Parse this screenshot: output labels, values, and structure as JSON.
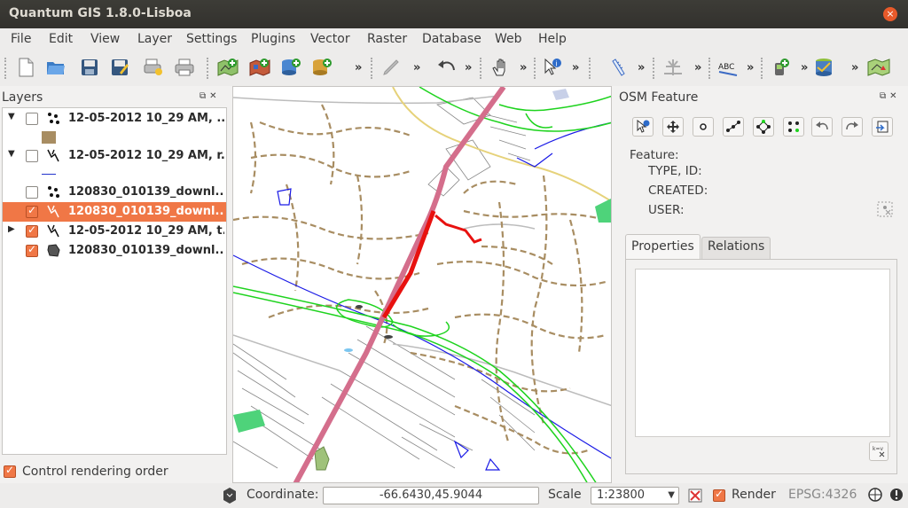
{
  "window": {
    "title": "Quantum GIS 1.8.0-Lisboa",
    "close_glyph": "×"
  },
  "menu": [
    "File",
    "Edit",
    "View",
    "Layer",
    "Settings",
    "Plugins",
    "Vector",
    "Raster",
    "Database",
    "Web",
    "Help"
  ],
  "toolbar": {
    "icons": [
      "new-project-icon",
      "open-project-icon",
      "save-project-icon",
      "save-as-icon",
      "new-print-composer-icon",
      "print-icon",
      "add-vector-layer-icon",
      "add-raster-layer-icon",
      "add-postgis-layer-icon",
      "add-spatialite-layer-icon",
      "pencil-edit-icon",
      "undo-icon",
      "pan-hand-icon",
      "identify-icon",
      "measure-icon",
      "snapping-icon",
      "label-icon",
      "gps-icon",
      "database-icon",
      "georeferencer-icon"
    ],
    "overflow_glyph": "»"
  },
  "layers_panel": {
    "title": "Layers",
    "rows": [
      {
        "label": "12-05-2012 10_29 AM, ...",
        "checked": false,
        "expander": "▼",
        "icon": "points-icon"
      },
      {
        "label": "12-05-2012 10_29 AM, r...",
        "checked": false,
        "expander": "▼",
        "icon": "lines-icon"
      },
      {
        "label": "120830_010139_downl...",
        "checked": false,
        "expander": "",
        "icon": "points-icon"
      },
      {
        "label": "120830_010139_downl...",
        "checked": true,
        "expander": "",
        "icon": "lines-icon",
        "selected": true
      },
      {
        "label": "12-05-2012 10_29 AM, t...",
        "checked": true,
        "expander": "▶",
        "icon": "lines-icon"
      },
      {
        "label": "120830_010139_downl...",
        "checked": true,
        "expander": "",
        "icon": "polygon-icon"
      }
    ],
    "control_rendering_order": "Control rendering order"
  },
  "osm_panel": {
    "title": "OSM Feature",
    "feature_label": "Feature:",
    "type_id_label": "TYPE, ID:",
    "created_label": "CREATED:",
    "user_label": "USER:",
    "tabs": [
      "Properties",
      "Relations"
    ],
    "tools": [
      "identify-feature-icon",
      "move-feature-icon",
      "create-point-icon",
      "create-line-icon",
      "create-polygon-icon",
      "select-nodes-icon",
      "undo-icon",
      "redo-icon",
      "import-data-icon"
    ]
  },
  "statusbar": {
    "coordinate_label": "Coordinate:",
    "coordinate_value": "-66.6430,45.9044",
    "scale_label": "Scale",
    "scale_value": "1:23800",
    "render_label": "Render",
    "epsg": "EPSG:4326",
    "render_checked": true
  },
  "colors": {
    "accent": "#f07746",
    "highway_pink": "#d46e8c",
    "highway_red": "#e8110f",
    "track_brown": "#a88d62",
    "green_road": "#1ed31e",
    "blue_line": "#1a1ae6"
  }
}
